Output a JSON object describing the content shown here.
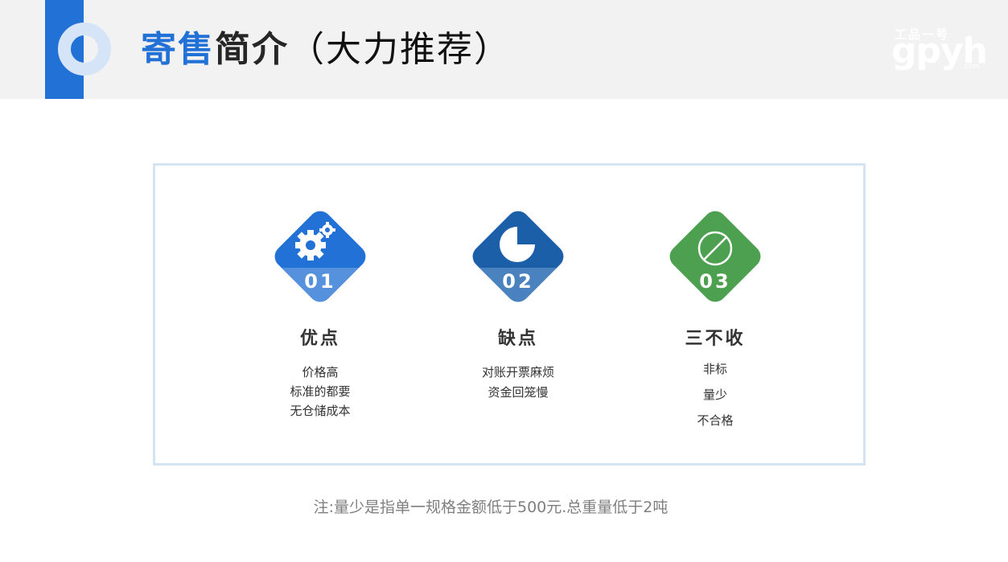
{
  "header": {
    "title_accent": "寄售",
    "title_rest": "简介",
    "title_paren": "（大力推荐）",
    "ring_icon": "ring-icon"
  },
  "watermark": {
    "top": "工品一号",
    "main": "gpyh",
    "sub": ".com"
  },
  "colors": {
    "brand_blue": "#2271d6",
    "card1": "#2271d6",
    "card2": "#1a5fa8",
    "card3": "#4ca04f",
    "text_dark": "#333333",
    "note_gray": "#7f7f7f"
  },
  "cards": [
    {
      "num": "01",
      "icon": "gears-icon",
      "heading": "优点",
      "lines": [
        "价格高",
        "标准的都要",
        "无仓储成本"
      ]
    },
    {
      "num": "02",
      "icon": "pie-chart-icon",
      "heading": "缺点",
      "lines": [
        "对账开票麻烦",
        "资金回笼慢"
      ]
    },
    {
      "num": "03",
      "icon": "no-entry-icon",
      "heading": "三不收",
      "lines": [
        "非标",
        "量少",
        "不合格"
      ]
    }
  ],
  "note": "注:量少是指单一规格金额低于500元.总重量低于2吨"
}
